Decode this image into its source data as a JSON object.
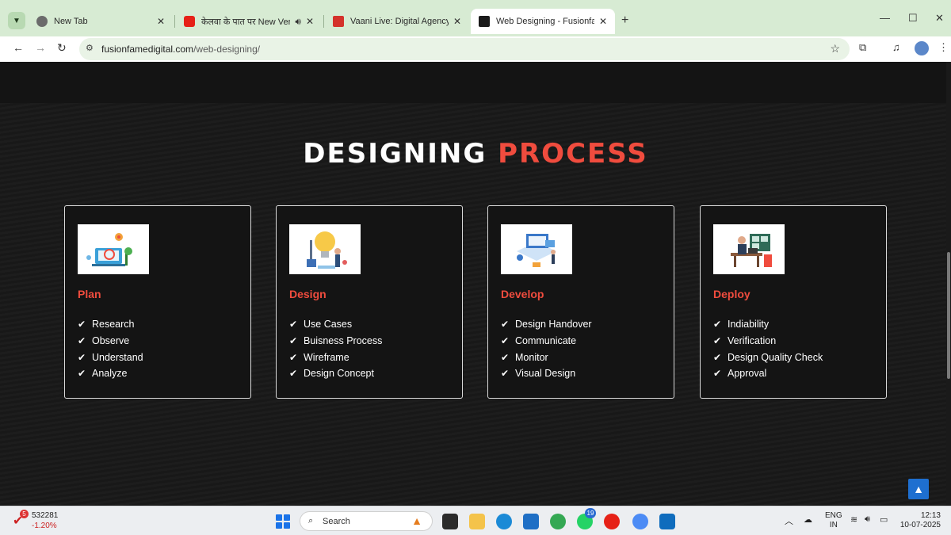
{
  "browser": {
    "tabs": [
      {
        "title": "New Tab",
        "active": false
      },
      {
        "title": "केलवा के पात पर New Version",
        "active": false
      },
      {
        "title": "Vaani Live: Digital Agency, Web",
        "active": false
      },
      {
        "title": "Web Designing - Fusionfame Di",
        "active": true
      }
    ],
    "url_domain": "fusionfamedigital.com",
    "url_path": "/web-designing/"
  },
  "page": {
    "heading_white": "DESIGNING",
    "heading_red": "PROCESS",
    "cards": [
      {
        "title": "Plan",
        "items": [
          "Research",
          "Observe",
          "Understand",
          "Analyze"
        ]
      },
      {
        "title": "Design",
        "items": [
          "Use Cases",
          "Buisness Process",
          "Wireframe",
          "Design Concept"
        ]
      },
      {
        "title": "Develop",
        "items": [
          "Design Handover",
          "Communicate",
          "Monitor",
          "Visual Design"
        ]
      },
      {
        "title": "Deploy",
        "items": [
          "Indiability",
          "Verification",
          "Design Quality Check",
          "Approval"
        ]
      }
    ]
  },
  "taskbar": {
    "stock_badge": "5",
    "stock_value": "532281",
    "stock_change": "-1.20%",
    "search_label": "Search",
    "whatsapp_badge": "19",
    "lang_line1": "ENG",
    "lang_line2": "IN",
    "time": "12:13",
    "date": "10-07-2025"
  },
  "colors": {
    "accent_red": "#f04c3e",
    "tabstrip": "#d7ebd3",
    "scroll_top_btn": "#1e6fd0"
  }
}
